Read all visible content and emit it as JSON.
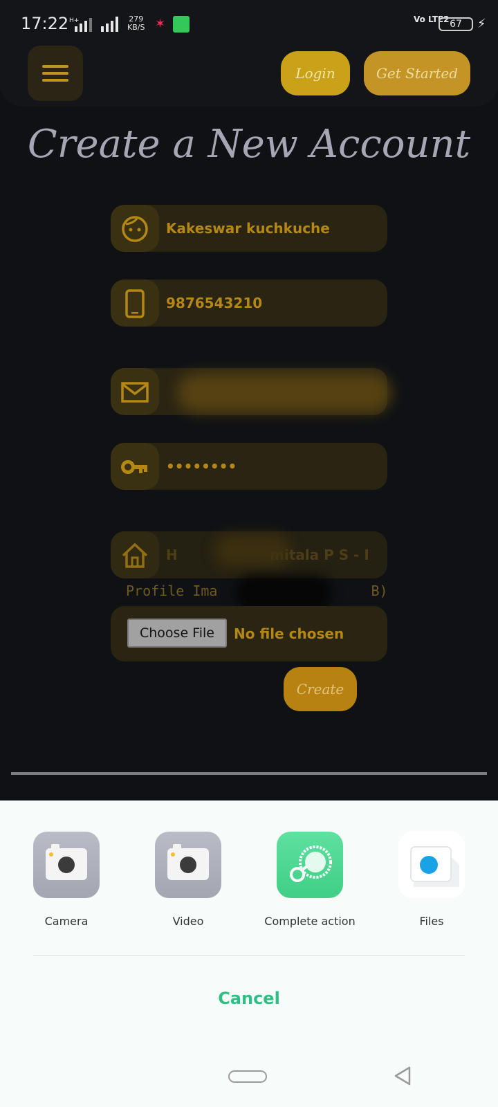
{
  "status_bar": {
    "time": "17:22",
    "network_speed_value": "279",
    "network_speed_unit": "KB/S",
    "volte": "Vo LTE2",
    "battery": "67"
  },
  "header": {
    "login_label": "Login",
    "get_started_label": "Get Started"
  },
  "form": {
    "title": "Create a New Account",
    "name_value": "Kakeswar kuchkuche",
    "phone_value": "9876543210",
    "password_value": "••••••••",
    "address_visible_value": "H",
    "address_visible_tail": "mitala P S - I",
    "profile_label_start": "Profile Ima",
    "profile_label_end": "B)",
    "choose_file_label": "Choose File",
    "no_file_label": "No file chosen",
    "create_label": "Create"
  },
  "colors": {
    "accent_gold": "#c9a21a",
    "field_bg": "#2a2412",
    "field_text": "#b58714",
    "cancel_green": "#2fbf85"
  },
  "chooser": {
    "apps": [
      {
        "label": "Camera",
        "icon": "camera-icon"
      },
      {
        "label": "Video",
        "icon": "video-camera-icon"
      },
      {
        "label": "Complete action",
        "icon": "complete-action-icon"
      },
      {
        "label": "Files",
        "icon": "files-icon"
      }
    ],
    "cancel_label": "Cancel"
  }
}
